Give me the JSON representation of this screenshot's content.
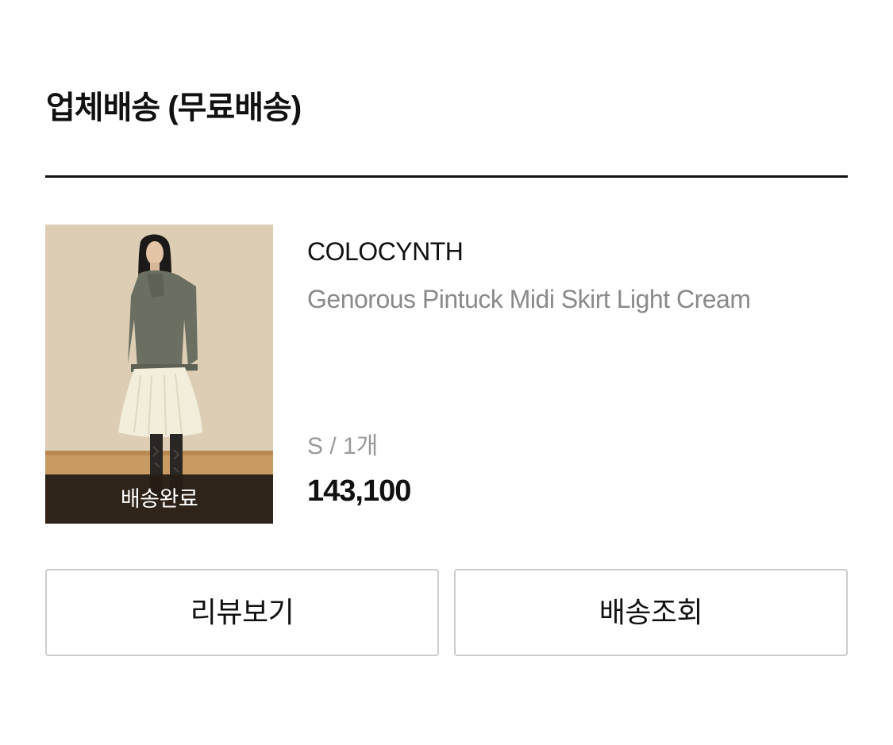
{
  "section": {
    "title": "업체배송 (무료배송)"
  },
  "order_item": {
    "status_label": "배송완료",
    "brand": "COLOCYNTH",
    "product_name": "Genorous Pintuck Midi Skirt Light Cream",
    "option": "S / 1개",
    "price": "143,100"
  },
  "actions": {
    "review_label": "리뷰보기",
    "tracking_label": "배송조회"
  },
  "colors": {
    "text": "#111111",
    "muted_text": "#8a8a8a",
    "divider": "#111111",
    "button_border": "#cccccc",
    "status_overlay": "#261e16"
  }
}
